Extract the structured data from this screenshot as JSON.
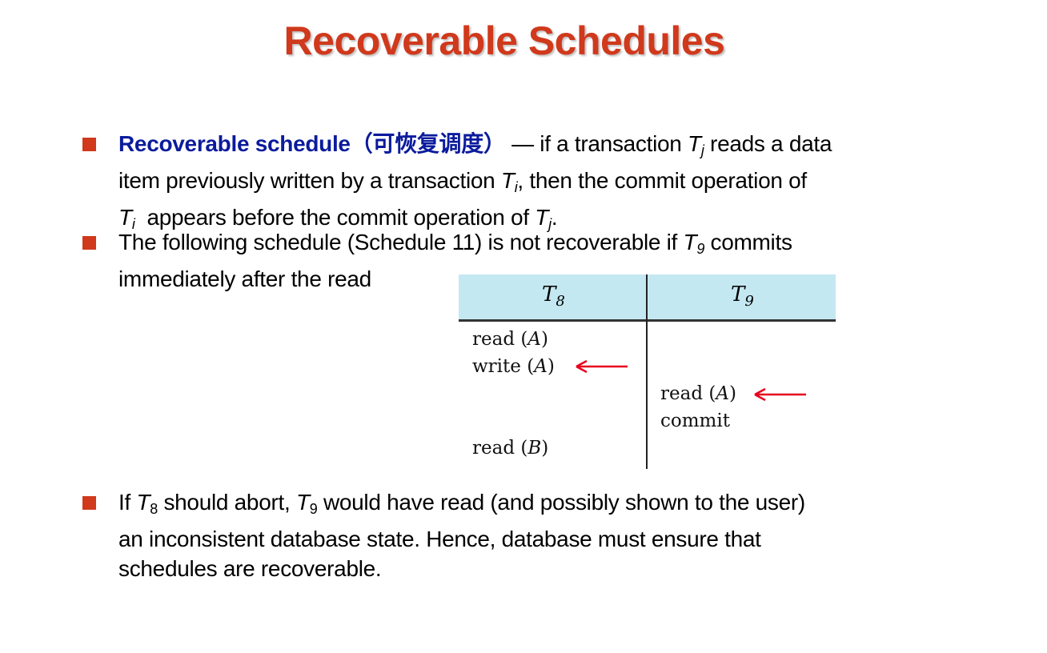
{
  "title": "Recoverable Schedules",
  "bullets": {
    "b1": {
      "term": "Recoverable schedule（可恢复调度）",
      "p1": " — if a transaction ",
      "t1": "T",
      "s1": "j",
      "p2": " reads a data",
      "p3": "item previously written by a transaction ",
      "t2": "T",
      "s2": "i",
      "p4": ", then the commit operation of",
      "t3": "T",
      "s3": "i",
      "p5": "  appears before the commit operation of ",
      "t4": "T",
      "s4": "j",
      "p6": "."
    },
    "b2": {
      "p1": "The following schedule (Schedule 11) is not recoverable if ",
      "t1": "T",
      "s1": "9",
      "p2": " commits",
      "p3": "immediately after the read"
    },
    "b3": {
      "p1": "If ",
      "t1": "T",
      "s1": "8",
      "p2": " should abort, ",
      "t2": "T",
      "s2": "9",
      "p3": " would have read (and possibly shown to the user)",
      "p4": "an inconsistent database state.  Hence, database must ensure that",
      "p5": "schedules are recoverable."
    }
  },
  "schedule": {
    "col1": {
      "T": "T",
      "sub": "8"
    },
    "col2": {
      "T": "T",
      "sub": "9"
    },
    "ops": [
      {
        "op": "read (",
        "item": "A",
        "close": ")"
      },
      {
        "op": "write (",
        "item": "A",
        "close": ")"
      },
      {
        "op": "read (",
        "item": "A",
        "close": ")"
      },
      {
        "op": "commit",
        "item": "",
        "close": ""
      },
      {
        "op": "read (",
        "item": "B",
        "close": ")"
      }
    ]
  },
  "colors": {
    "title": "#D0391C",
    "term": "#0B1B9C",
    "header": "#C4E8F1",
    "arrow": "#E8001C"
  }
}
